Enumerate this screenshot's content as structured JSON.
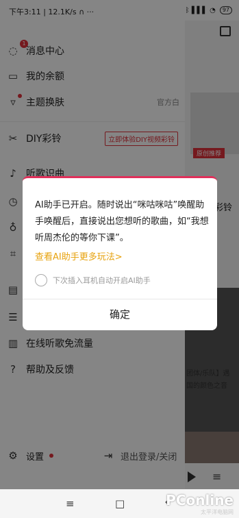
{
  "status_bar": {
    "time": "下午3:11",
    "speed": "12.1K/s",
    "icons": "ᛒ ▌▌▌ ◔",
    "battery": "97"
  },
  "background": {
    "badge": "原创推荐",
    "ring_label": "彩铃",
    "caption1": "团体/乐队】遇",
    "caption2": "国的颜色之音"
  },
  "drawer": {
    "items": [
      {
        "label": "消息中心",
        "icon": "message-icon",
        "badge": "1"
      },
      {
        "label": "我的余额",
        "icon": "wallet-icon"
      },
      {
        "label": "主题换肤",
        "icon": "shirt-icon",
        "right": "官方白"
      },
      {
        "label": "DIY彩铃",
        "icon": "scissors-icon",
        "right": "立即体验DIY视频彩铃"
      },
      {
        "label": "听歌识曲",
        "icon": "music-note-icon"
      },
      {
        "label": "在线听歌免流量",
        "icon": "data-icon"
      },
      {
        "label": "帮助及反馈",
        "icon": "help-icon"
      }
    ],
    "settings_label": "设置",
    "logout_label": "退出登录/关闭"
  },
  "dialog": {
    "message": "AI助手已开启。随时说出“咪咕咪咕”唤醒助手唤醒后，直接说出您想听的歌曲，如“我想听周杰伦的等你下课”。",
    "link": "查看AI助手更多玩法>",
    "checkbox_label": "下次插入耳机自动开启AI助手",
    "confirm": "确定"
  },
  "nav_bar": {
    "menu": "≡",
    "home": "□",
    "back": "‹"
  },
  "watermark": {
    "main": "PConline",
    "sub": "太平洋电脑网"
  }
}
